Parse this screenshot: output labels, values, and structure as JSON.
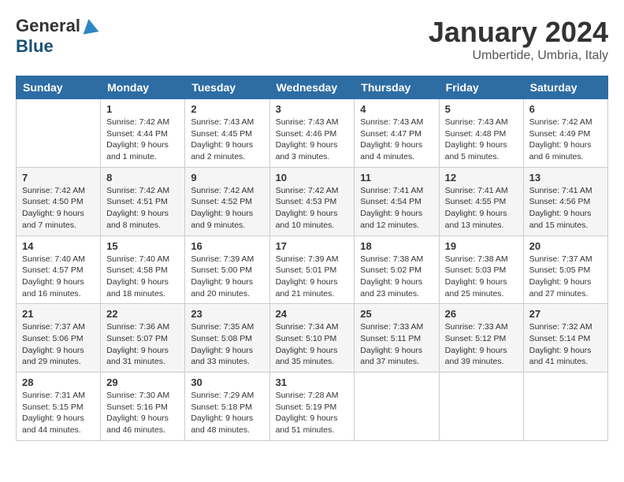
{
  "logo": {
    "general": "General",
    "blue": "Blue"
  },
  "title": "January 2024",
  "location": "Umbertide, Umbria, Italy",
  "headers": [
    "Sunday",
    "Monday",
    "Tuesday",
    "Wednesday",
    "Thursday",
    "Friday",
    "Saturday"
  ],
  "weeks": [
    [
      {
        "day": "",
        "info": ""
      },
      {
        "day": "1",
        "info": "Sunrise: 7:42 AM\nSunset: 4:44 PM\nDaylight: 9 hours\nand 1 minute."
      },
      {
        "day": "2",
        "info": "Sunrise: 7:43 AM\nSunset: 4:45 PM\nDaylight: 9 hours\nand 2 minutes."
      },
      {
        "day": "3",
        "info": "Sunrise: 7:43 AM\nSunset: 4:46 PM\nDaylight: 9 hours\nand 3 minutes."
      },
      {
        "day": "4",
        "info": "Sunrise: 7:43 AM\nSunset: 4:47 PM\nDaylight: 9 hours\nand 4 minutes."
      },
      {
        "day": "5",
        "info": "Sunrise: 7:43 AM\nSunset: 4:48 PM\nDaylight: 9 hours\nand 5 minutes."
      },
      {
        "day": "6",
        "info": "Sunrise: 7:42 AM\nSunset: 4:49 PM\nDaylight: 9 hours\nand 6 minutes."
      }
    ],
    [
      {
        "day": "7",
        "info": "Sunrise: 7:42 AM\nSunset: 4:50 PM\nDaylight: 9 hours\nand 7 minutes."
      },
      {
        "day": "8",
        "info": "Sunrise: 7:42 AM\nSunset: 4:51 PM\nDaylight: 9 hours\nand 8 minutes."
      },
      {
        "day": "9",
        "info": "Sunrise: 7:42 AM\nSunset: 4:52 PM\nDaylight: 9 hours\nand 9 minutes."
      },
      {
        "day": "10",
        "info": "Sunrise: 7:42 AM\nSunset: 4:53 PM\nDaylight: 9 hours\nand 10 minutes."
      },
      {
        "day": "11",
        "info": "Sunrise: 7:41 AM\nSunset: 4:54 PM\nDaylight: 9 hours\nand 12 minutes."
      },
      {
        "day": "12",
        "info": "Sunrise: 7:41 AM\nSunset: 4:55 PM\nDaylight: 9 hours\nand 13 minutes."
      },
      {
        "day": "13",
        "info": "Sunrise: 7:41 AM\nSunset: 4:56 PM\nDaylight: 9 hours\nand 15 minutes."
      }
    ],
    [
      {
        "day": "14",
        "info": "Sunrise: 7:40 AM\nSunset: 4:57 PM\nDaylight: 9 hours\nand 16 minutes."
      },
      {
        "day": "15",
        "info": "Sunrise: 7:40 AM\nSunset: 4:58 PM\nDaylight: 9 hours\nand 18 minutes."
      },
      {
        "day": "16",
        "info": "Sunrise: 7:39 AM\nSunset: 5:00 PM\nDaylight: 9 hours\nand 20 minutes."
      },
      {
        "day": "17",
        "info": "Sunrise: 7:39 AM\nSunset: 5:01 PM\nDaylight: 9 hours\nand 21 minutes."
      },
      {
        "day": "18",
        "info": "Sunrise: 7:38 AM\nSunset: 5:02 PM\nDaylight: 9 hours\nand 23 minutes."
      },
      {
        "day": "19",
        "info": "Sunrise: 7:38 AM\nSunset: 5:03 PM\nDaylight: 9 hours\nand 25 minutes."
      },
      {
        "day": "20",
        "info": "Sunrise: 7:37 AM\nSunset: 5:05 PM\nDaylight: 9 hours\nand 27 minutes."
      }
    ],
    [
      {
        "day": "21",
        "info": "Sunrise: 7:37 AM\nSunset: 5:06 PM\nDaylight: 9 hours\nand 29 minutes."
      },
      {
        "day": "22",
        "info": "Sunrise: 7:36 AM\nSunset: 5:07 PM\nDaylight: 9 hours\nand 31 minutes."
      },
      {
        "day": "23",
        "info": "Sunrise: 7:35 AM\nSunset: 5:08 PM\nDaylight: 9 hours\nand 33 minutes."
      },
      {
        "day": "24",
        "info": "Sunrise: 7:34 AM\nSunset: 5:10 PM\nDaylight: 9 hours\nand 35 minutes."
      },
      {
        "day": "25",
        "info": "Sunrise: 7:33 AM\nSunset: 5:11 PM\nDaylight: 9 hours\nand 37 minutes."
      },
      {
        "day": "26",
        "info": "Sunrise: 7:33 AM\nSunset: 5:12 PM\nDaylight: 9 hours\nand 39 minutes."
      },
      {
        "day": "27",
        "info": "Sunrise: 7:32 AM\nSunset: 5:14 PM\nDaylight: 9 hours\nand 41 minutes."
      }
    ],
    [
      {
        "day": "28",
        "info": "Sunrise: 7:31 AM\nSunset: 5:15 PM\nDaylight: 9 hours\nand 44 minutes."
      },
      {
        "day": "29",
        "info": "Sunrise: 7:30 AM\nSunset: 5:16 PM\nDaylight: 9 hours\nand 46 minutes."
      },
      {
        "day": "30",
        "info": "Sunrise: 7:29 AM\nSunset: 5:18 PM\nDaylight: 9 hours\nand 48 minutes."
      },
      {
        "day": "31",
        "info": "Sunrise: 7:28 AM\nSunset: 5:19 PM\nDaylight: 9 hours\nand 51 minutes."
      },
      {
        "day": "",
        "info": ""
      },
      {
        "day": "",
        "info": ""
      },
      {
        "day": "",
        "info": ""
      }
    ]
  ]
}
